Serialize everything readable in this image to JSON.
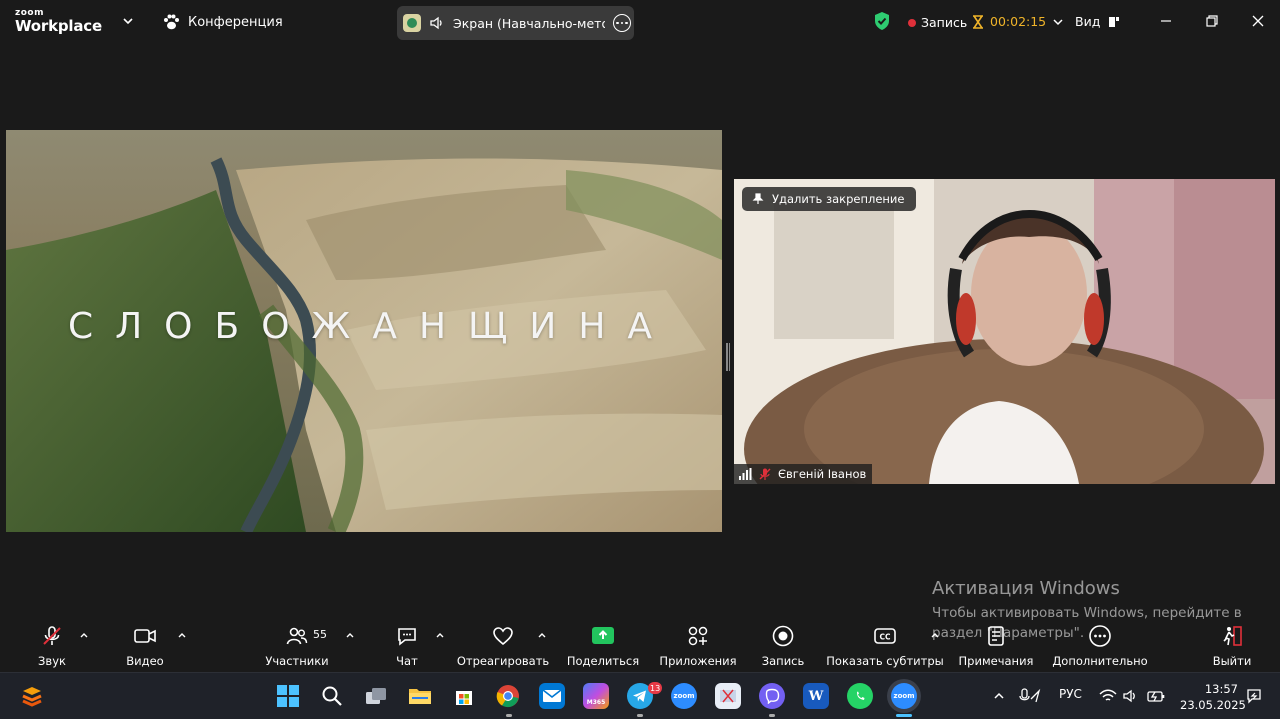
{
  "window": {
    "logo_top": "zoom",
    "logo_bottom": "Workplace",
    "conference_label": "Конференция",
    "share_title": "Экран (Навчально-методич",
    "record_label": "Запись",
    "timer": "00:02:15",
    "view_label": "Вид"
  },
  "shared_screen": {
    "overlay_text": "СЛОБОЖАНЩИНА"
  },
  "video_tile": {
    "unpin_label": "Удалить закрепление",
    "participant_name": "Євгеній Іванов"
  },
  "activation": {
    "title": "Активация Windows",
    "subtitle": "Чтобы активировать Windows, перейдите в раздел \"Параметры\"."
  },
  "toolbar": {
    "audio": "Звук",
    "video": "Видео",
    "participants": "Участники",
    "participants_count": "55",
    "chat": "Чат",
    "react": "Отреагировать",
    "share": "Поделиться",
    "apps": "Приложения",
    "record": "Запись",
    "captions": "Показать субтитры",
    "notes": "Примечания",
    "more": "Дополнительно",
    "leave": "Выйти"
  },
  "taskbar": {
    "telegram_badge": "13",
    "language": "РУС",
    "time": "13:57",
    "date": "23.05.2025",
    "zoom_label": "zoom",
    "m365_label": "M365"
  },
  "colors": {
    "accent_green": "#2ecc71",
    "record_red": "#e0303a",
    "timer_amber": "#f0b429",
    "share_green": "#22c55e",
    "leave_red": "#e0303a"
  }
}
